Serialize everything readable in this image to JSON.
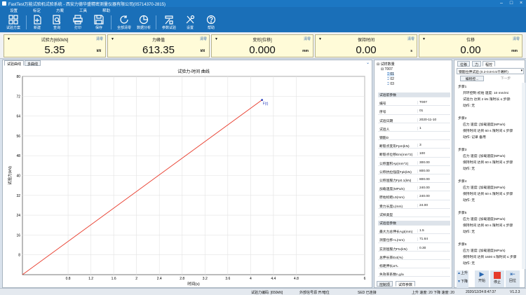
{
  "window": {
    "title": "FastTest万能试验机试验系统 - 西安力德华盛精密测量仪器有限公司(05714370-2815)"
  },
  "menu": [
    "设置",
    "标定",
    "方案",
    "工具",
    "帮助"
  ],
  "toolbar": [
    {
      "label": "试验方案",
      "icon": "grid-icon"
    },
    {
      "label": "新建",
      "icon": "new-doc-icon"
    },
    {
      "label": "查询",
      "icon": "search-icon"
    },
    {
      "label": "打印",
      "icon": "print-icon"
    },
    {
      "label": "保存",
      "icon": "save-icon"
    },
    {
      "label": "全部清零",
      "icon": "reset-icon"
    },
    {
      "label": "数据分析",
      "icon": "pie-icon"
    },
    {
      "label": "参数试验",
      "icon": "params-icon"
    },
    {
      "label": "设置",
      "icon": "tools-icon"
    },
    {
      "label": "帮助",
      "icon": "help-icon"
    }
  ],
  "meters": [
    {
      "label": "试验力[650kN]",
      "value": "5.35",
      "unit": "kN",
      "reset": "清零"
    },
    {
      "label": "力峰值",
      "value": "613.35",
      "unit": "kN",
      "reset": "清零"
    },
    {
      "label": "变形[位移]",
      "value": "0.000",
      "unit": "mm",
      "reset": "清零"
    },
    {
      "label": "保持时间",
      "value": "0.00",
      "unit": "s",
      "reset": "清零"
    },
    {
      "label": "位移",
      "value": "0.00",
      "unit": "mm",
      "reset": "清零"
    }
  ],
  "left_tabs": [
    "试验曲线",
    "多曲线"
  ],
  "chart_data": {
    "type": "line",
    "title": "试验力-时间 曲线",
    "xlabel": "时间(s)",
    "ylabel": "试验力(kN)",
    "xlim": [
      0,
      6
    ],
    "ylim": [
      0,
      80
    ],
    "xticks": [
      "0.8",
      "1.2",
      "1.6",
      "2",
      "2.4",
      "2.8",
      "3.2",
      "3.6",
      "4",
      "4.4",
      "4.8",
      "6"
    ],
    "yticks": [
      "8",
      "16",
      "24",
      "32",
      "40",
      "48",
      "56",
      "64",
      "72",
      "80"
    ],
    "series": [
      {
        "x": [
          0,
          4.2
        ],
        "y": [
          0,
          70.5
        ],
        "color": "#e83a2a"
      }
    ],
    "marker": {
      "x": 4.2,
      "y": 70.5,
      "label": "F(t)"
    },
    "grid": true
  },
  "tree": {
    "root": "试样数量",
    "group": "T007",
    "items": [
      "01",
      "02",
      "03"
    ]
  },
  "params": [
    {
      "k": "试验前参数",
      "v": "",
      "hdr": true
    },
    {
      "k": "编号",
      "v": "T007"
    },
    {
      "k": "序号",
      "v": "01"
    },
    {
      "k": "试验日期",
      "v": "2020-11-10"
    },
    {
      "k": "试验人",
      "v": "1"
    },
    {
      "k": "钢筋D",
      "v": ""
    },
    {
      "k": "断裂点变形Fpm(kN)",
      "v": "3"
    },
    {
      "k": "断裂点位移Em(mm^2)",
      "v": "100"
    },
    {
      "k": "公称面积Ap(mm^2)",
      "v": "300.00"
    },
    {
      "k": "公称抗拉强度Fpk(kN)",
      "v": "800.00"
    },
    {
      "k": "公称屈服力Fp0.1(kN)",
      "v": "800.00"
    },
    {
      "k": "加载速度(MPa/s)",
      "v": "240.00"
    },
    {
      "k": "原始标距L0(mm)",
      "v": "240.00"
    },
    {
      "k": "受力长度L(mm)",
      "v": "24.00"
    },
    {
      "k": "试样类型",
      "v": ""
    },
    {
      "k": "试验后参数",
      "v": "",
      "hdr": true
    },
    {
      "k": "最大力总伸长Agt(mm)",
      "v": "1.5"
    },
    {
      "k": "测量位移+L(mm)",
      "v": "71.64"
    },
    {
      "k": "实测屈服力Ftx(kN)",
      "v": "0.30"
    },
    {
      "k": "总伸长率Ext(%)",
      "v": ""
    },
    {
      "k": "标距伸长Δ*L",
      "v": ""
    },
    {
      "k": "失效率系数n,g/a",
      "v": ""
    }
  ],
  "mid_tabs": [
    "控制项",
    "试样参数"
  ],
  "right_tabs": [
    "位移",
    "力",
    "程控"
  ],
  "program": {
    "select": "钢筋拉伸试验 (0.2-0.8-0.5千端杆)",
    "edit": "编程控...",
    "next": "下一步",
    "steps": [
      {
        "title": "步骤1",
        "lines": [
          "开环控制-初始 速度: 10 mm/mi",
          "试验力 达到 2 kN 限时长 ≤ 步骤:",
          "动作: 无"
        ]
      },
      {
        "title": "步骤2",
        "lines": [
          "应力 速度: [加载速度(MPa/s)",
          "保持时间 达到 60 s 限时间 ≤ 步骤",
          "动作: 记录 备用"
        ]
      },
      {
        "title": "步骤3",
        "lines": [
          "应力 速度: [加载速度(MPa/s)",
          "保持时间 达到 60 s 限时间 ≤ 步骤",
          "动作: 无"
        ]
      },
      {
        "title": "步骤4",
        "lines": [
          "应力 速度: [加载速度(MPa/s)",
          "保持时间 达到 60 s 限时间 ≤ 步骤",
          "动作: 无"
        ]
      },
      {
        "title": "步骤5",
        "lines": [
          "应力 速度: [加载速度(MPa/s)",
          "保持时间 达到 60 s 限时间 ≤ 步骤",
          "动作: 无"
        ]
      },
      {
        "title": "步骤6",
        "lines": [
          "应力 速度: [加载速度(MPa/s)",
          "保持时间 达到 1600 s 限时间 ≤ 步骤",
          "动作: 无"
        ]
      }
    ],
    "buttons": {
      "up": "上升",
      "down": "下降",
      "start": "开始",
      "stop": "停止",
      "back": "回位"
    }
  },
  "status": {
    "force": "试验力编码: [650kN]",
    "signal": "外部信号源 开/暗位",
    "sed": "SED 已连接",
    "limits": "上升 速度: 20  下降 速度: 20",
    "datetime": "2020/12/24 8:47:37",
    "version": "V1.2.3"
  }
}
